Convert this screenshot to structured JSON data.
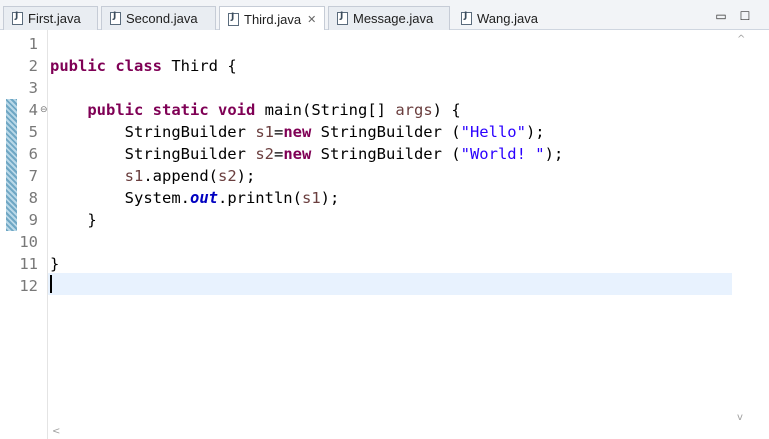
{
  "tabs": [
    {
      "label": "First.java",
      "active": false
    },
    {
      "label": "Second.java",
      "active": false
    },
    {
      "label": "Third.java",
      "active": true
    },
    {
      "label": "Message.java",
      "active": false
    },
    {
      "label": "Wang.java",
      "active": false
    }
  ],
  "window_controls": {
    "minimize": "▭",
    "maximize": "☐"
  },
  "active_tab_close": "✕",
  "line_numbers": [
    "1",
    "2",
    "3",
    "4",
    "5",
    "6",
    "7",
    "8",
    "9",
    "10",
    "11",
    "12"
  ],
  "fold_marker": "⊖",
  "code": {
    "l2": {
      "kw1": "public",
      "kw2": "class",
      "rest": " Third {"
    },
    "l4": {
      "indent": "    ",
      "kw1": "public",
      "kw2": "static",
      "kw3": "void",
      "rest1": " main(String[] ",
      "param": "args",
      "rest2": ") {"
    },
    "l5": {
      "indent": "        ",
      "t1": "StringBuilder ",
      "var": "s1",
      "t2": "=",
      "kw": "new",
      "t3": " StringBuilder (",
      "str": "\"Hello\"",
      "t4": ");"
    },
    "l6": {
      "indent": "        ",
      "t1": "StringBuilder ",
      "var": "s2",
      "t2": "=",
      "kw": "new",
      "t3": " StringBuilder (",
      "str": "\"World! \"",
      "t4": ");"
    },
    "l7": {
      "indent": "        ",
      "var1": "s1",
      "t1": ".append(",
      "var2": "s2",
      "t2": ");"
    },
    "l8": {
      "indent": "        ",
      "t1": "System.",
      "fld": "out",
      "t2": ".println(",
      "var": "s1",
      "t3": ");"
    },
    "l9": {
      "indent": "    ",
      "t1": "}"
    },
    "l11": {
      "t1": "}"
    }
  },
  "scroll_arrows": {
    "up": "^",
    "down": "v",
    "left": "<"
  }
}
